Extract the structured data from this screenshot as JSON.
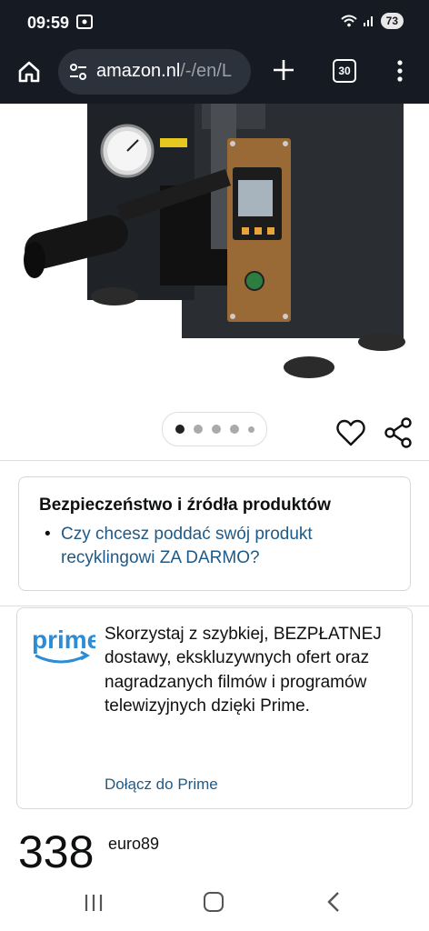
{
  "status_bar": {
    "time": "09:59",
    "battery": "73",
    "cast_icon": "cast-icon",
    "wifi_icon": "wifi-icon",
    "signal_icon": "signal-icon"
  },
  "browser": {
    "url_host": "amazon.nl",
    "url_path": "/-/en/L",
    "tab_count": "30",
    "icons": [
      "home-icon",
      "tune-icon",
      "plus-icon",
      "tabs-icon",
      "more-vert-icon"
    ]
  },
  "carousel": {
    "total": 5,
    "active": 1
  },
  "safety": {
    "title": "Bezpieczeństwo i źródła produktów",
    "bullet": "•",
    "link": "Czy chcesz poddać swój produkt recyklingowi ZA DARMO?"
  },
  "prime": {
    "logo_text": "prime",
    "description": "Skorzystaj z szybkiej, BEZPŁATNEJ dostawy, ekskluzywnych ofert oraz nagradzanych filmów i programów telewizyjnych dzięki Prime.",
    "join_link": "Dołącz do Prime"
  },
  "price": {
    "whole": "338",
    "fraction": "euro89"
  },
  "colors": {
    "link": "#1f5a87",
    "prime_blue": "#2e8cd5",
    "bar_bg": "#161a22"
  }
}
